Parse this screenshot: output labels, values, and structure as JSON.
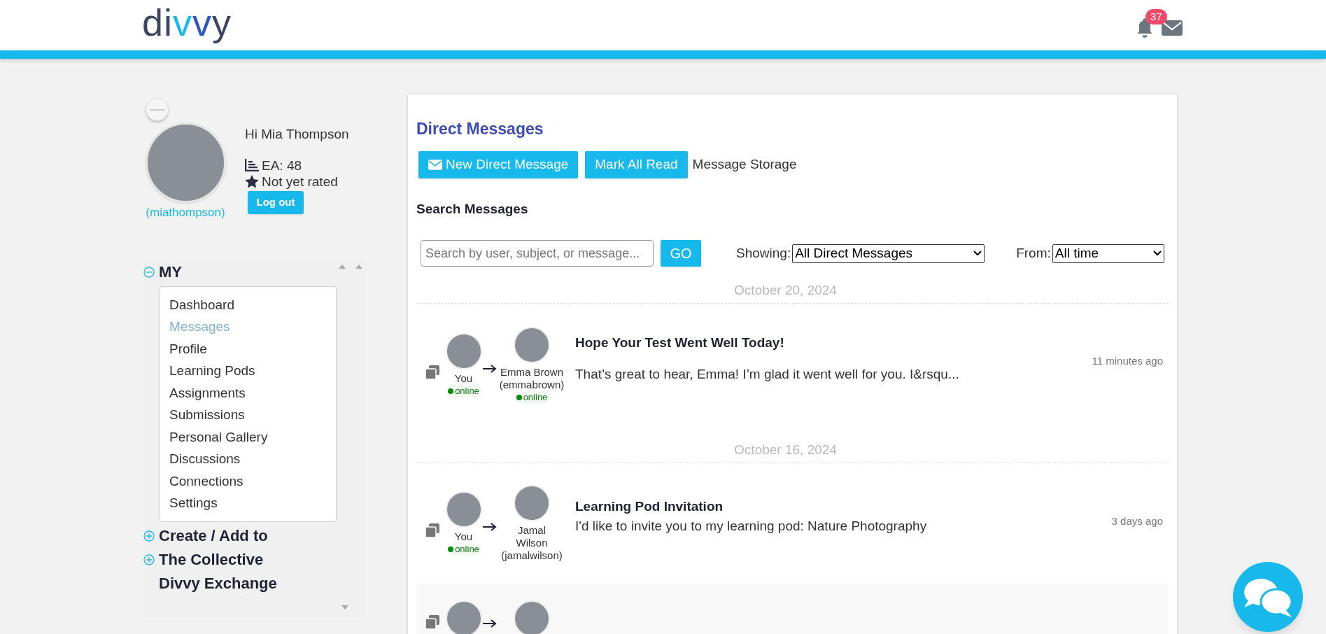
{
  "header": {
    "logo": "divvy",
    "notification_count": "37"
  },
  "sidebar": {
    "greeting": "Hi Mia Thompson",
    "ea": "EA: 48",
    "rating": "Not yet rated",
    "logout": "Log out",
    "username": "(miathompson)",
    "sections": [
      {
        "label": "MY",
        "kind": "toggle",
        "expanded": true,
        "items": [
          {
            "label": "Dashboard",
            "selected": false
          },
          {
            "label": "Messages",
            "selected": true
          },
          {
            "label": "Profile",
            "selected": false
          },
          {
            "label": "Learning Pods",
            "selected": false
          },
          {
            "label": "Assignments",
            "selected": false
          },
          {
            "label": "Submissions",
            "selected": false
          },
          {
            "label": "Personal Gallery",
            "selected": false
          },
          {
            "label": "Discussions",
            "selected": false
          },
          {
            "label": "Connections",
            "selected": false
          },
          {
            "label": "Settings",
            "selected": false
          }
        ]
      },
      {
        "label": "Create / Add to",
        "kind": "toggle",
        "expanded": false
      },
      {
        "label": "The Collective",
        "kind": "toggle",
        "expanded": false
      },
      {
        "label": "Divvy Exchange",
        "kind": "link"
      }
    ]
  },
  "main": {
    "title": "Direct Messages",
    "buttons": [
      "New Direct Message",
      "Mark All Read"
    ],
    "storage_link": "Message Storage",
    "search_heading": "Search Messages",
    "search": {
      "placeholder": "Search by user, subject, or message..."
    },
    "go": "GO",
    "filters": [
      {
        "label": "Showing:",
        "value": "All Direct Messages"
      },
      {
        "label": "From:",
        "value": "All time"
      }
    ],
    "groups": [
      {
        "date": "October 20, 2024",
        "messages": [
          {
            "highlighted": false,
            "sender": {
              "name": "You",
              "status": "online"
            },
            "recipient": {
              "name": "Emma Brown",
              "username": "(emmabrown)",
              "status": "online"
            },
            "subject": "Hope Your Test Went Well Today!",
            "preview": "That’s great to hear, Emma! I’m glad it went well for you. I&rsqu...",
            "time": "11 minutes ago"
          }
        ]
      },
      {
        "date": "October 16, 2024",
        "messages": [
          {
            "highlighted": false,
            "sender": {
              "name": "You",
              "status": "online"
            },
            "recipient": {
              "name": "Jamal Wilson",
              "username": "(jamalwilson)"
            },
            "subject": "Learning Pod Invitation",
            "preview": "I'd like to invite you to my learning pod: Nature Photography",
            "time": "3 days ago"
          },
          {
            "highlighted": true
          }
        ]
      }
    ]
  }
}
